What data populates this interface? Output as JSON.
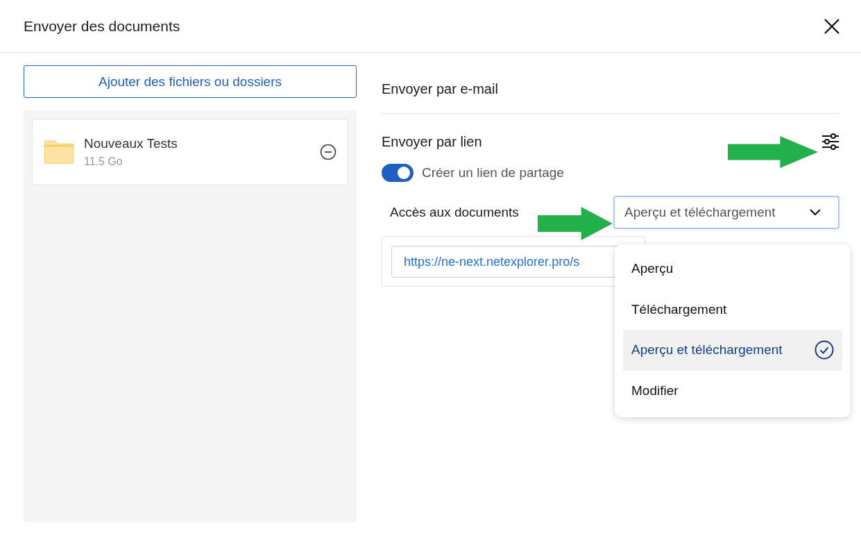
{
  "dialog": {
    "title": "Envoyer des documents"
  },
  "add_button": {
    "label": "Ajouter des fichiers ou dossiers"
  },
  "files": [
    {
      "name": "Nouveaux Tests",
      "size": "11.5 Go"
    }
  ],
  "email_section": {
    "title": "Envoyer par e-mail"
  },
  "link_section": {
    "title": "Envoyer par lien",
    "toggle": {
      "label": "Créer un lien de partage",
      "on": true
    },
    "access": {
      "label": "Accès aux documents",
      "value": "Aperçu et téléchargement",
      "expanded": true
    },
    "link": {
      "value": "https://ne-next.netexplorer.pro/s"
    }
  },
  "access_options": [
    {
      "label": "Aperçu",
      "selected": false
    },
    {
      "label": "Téléchargement",
      "selected": false
    },
    {
      "label": "Aperçu et téléchargement",
      "selected": true
    },
    {
      "label": "Modifier",
      "selected": false
    }
  ]
}
